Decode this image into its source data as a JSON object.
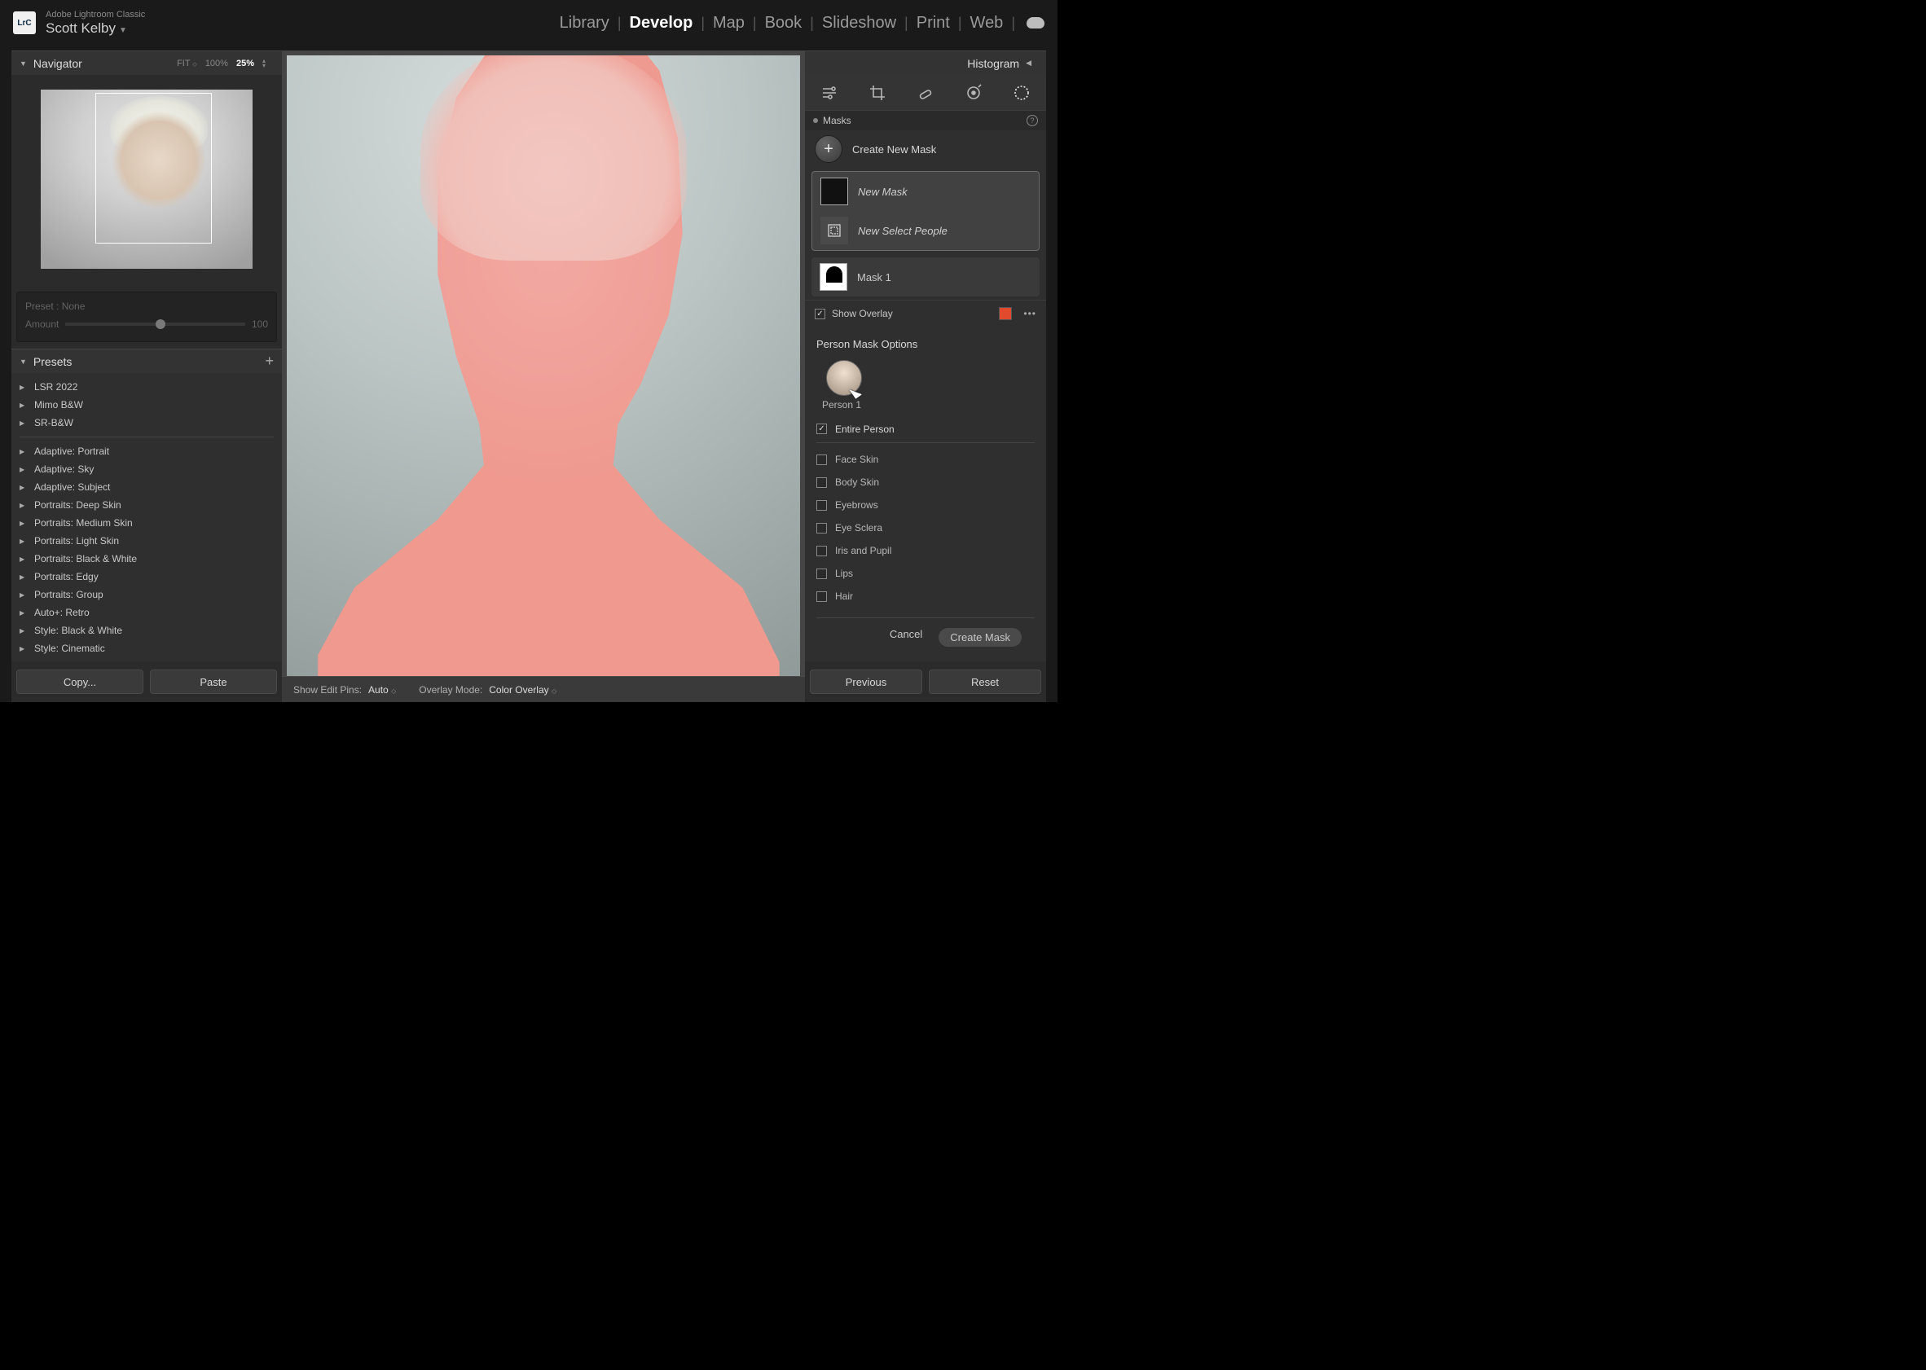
{
  "app": {
    "logo": "LrC",
    "title_small": "Adobe Lightroom Classic",
    "user": "Scott Kelby"
  },
  "modules": [
    "Library",
    "Develop",
    "Map",
    "Book",
    "Slideshow",
    "Print",
    "Web"
  ],
  "module_active": "Develop",
  "left": {
    "navigator": {
      "title": "Navigator",
      "zooms": [
        "FIT",
        "100%",
        "25%"
      ],
      "zoom_active": "25%"
    },
    "dim_panel": {
      "preset_label": "Preset :",
      "preset_value": "None",
      "amount_label": "Amount",
      "amount_value": "100"
    },
    "presets": {
      "title": "Presets",
      "items_top": [
        "LSR 2022",
        "Mimo B&W",
        "SR-B&W"
      ],
      "items_bottom": [
        "Adaptive: Portrait",
        "Adaptive: Sky",
        "Adaptive: Subject",
        "Portraits: Deep Skin",
        "Portraits: Medium Skin",
        "Portraits: Light Skin",
        "Portraits: Black & White",
        "Portraits: Edgy",
        "Portraits: Group",
        "Auto+: Retro",
        "Style: Black & White",
        "Style: Cinematic"
      ]
    },
    "buttons": {
      "copy": "Copy...",
      "paste": "Paste"
    }
  },
  "center": {
    "edit_pins_label": "Show Edit Pins:",
    "edit_pins_value": "Auto",
    "overlay_mode_label": "Overlay Mode:",
    "overlay_mode_value": "Color Overlay"
  },
  "right": {
    "histogram_title": "Histogram",
    "masks_label": "Masks",
    "create_new_mask": "Create New Mask",
    "new_mask": "New Mask",
    "new_select_people": "New Select People",
    "mask1": "Mask 1",
    "show_overlay": "Show Overlay",
    "overlay_color": "#e24a2e",
    "pmo_title": "Person Mask Options",
    "person1": "Person 1",
    "entire_person": "Entire Person",
    "options": [
      "Face Skin",
      "Body Skin",
      "Eyebrows",
      "Eye Sclera",
      "Iris and Pupil",
      "Lips",
      "Hair"
    ],
    "cancel": "Cancel",
    "create_mask": "Create Mask",
    "previous": "Previous",
    "reset": "Reset"
  }
}
